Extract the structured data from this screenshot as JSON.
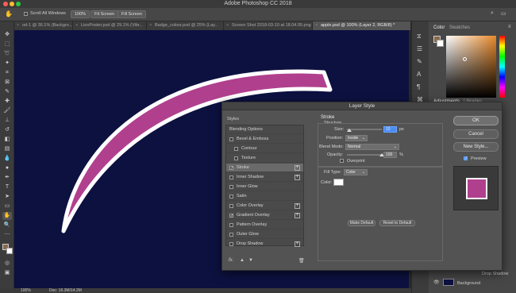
{
  "app": {
    "title": "Adobe Photoshop CC 2018"
  },
  "options": {
    "scroll_all": "Scroll All Windows",
    "zoom": "100%",
    "fit_screen": "Fit Screen",
    "fill_screen": "Fill Screen"
  },
  "tabs": [
    {
      "label": "od-1 @ 36.1% (Backgro..."
    },
    {
      "label": "LionPoster.psd @ 29.1% (Vibr..."
    },
    {
      "label": "Badge_colour.psd @ 25% (Lay..."
    },
    {
      "label": "Screen Shot 2018-03-10 at 18.04.05.png"
    },
    {
      "label": "apple.psd @ 100% (Layer 2, RGB/8) *"
    }
  ],
  "status": {
    "zoom": "100%",
    "doc": "Doc: 16.3M/14.2M"
  },
  "colors": {
    "canvas_bg": "#0d1140",
    "shape_fill": "#b0408e",
    "stroke": "#ffffff",
    "accent": "#4a8df6"
  },
  "right_panel": {
    "color_tab": "Color",
    "swatches_tab": "Swatches",
    "adjustments_tab": "Adjustments",
    "libraries_tab": "Libraries",
    "drop_shadow": "Drop Shadow",
    "layer_label": "Background"
  },
  "dialog": {
    "title": "Layer Style",
    "styles_header": "Styles",
    "style_items": [
      {
        "label": "Blending Options",
        "checkbox": false,
        "checked": false,
        "plus": false,
        "indent": false
      },
      {
        "label": "Bevel & Emboss",
        "checkbox": true,
        "checked": false,
        "plus": false,
        "indent": false
      },
      {
        "label": "Contour",
        "checkbox": true,
        "checked": false,
        "plus": false,
        "indent": true
      },
      {
        "label": "Texture",
        "checkbox": true,
        "checked": false,
        "plus": false,
        "indent": true
      },
      {
        "label": "Stroke",
        "checkbox": true,
        "checked": true,
        "plus": true,
        "indent": false
      },
      {
        "label": "Inner Shadow",
        "checkbox": true,
        "checked": false,
        "plus": true,
        "indent": false
      },
      {
        "label": "Inner Glow",
        "checkbox": true,
        "checked": false,
        "plus": false,
        "indent": false
      },
      {
        "label": "Satin",
        "checkbox": true,
        "checked": false,
        "plus": false,
        "indent": false
      },
      {
        "label": "Color Overlay",
        "checkbox": true,
        "checked": false,
        "plus": true,
        "indent": false
      },
      {
        "label": "Gradient Overlay",
        "checkbox": true,
        "checked": true,
        "plus": true,
        "indent": false
      },
      {
        "label": "Pattern Overlay",
        "checkbox": true,
        "checked": false,
        "plus": false,
        "indent": false
      },
      {
        "label": "Outer Glow",
        "checkbox": true,
        "checked": false,
        "plus": false,
        "indent": false
      },
      {
        "label": "Drop Shadow",
        "checkbox": true,
        "checked": false,
        "plus": true,
        "indent": false
      }
    ],
    "stroke": {
      "heading": "Stroke",
      "structure": "Structure",
      "size_label": "Size:",
      "size_value": "10",
      "size_unit": "px",
      "position_label": "Position:",
      "position_value": "Inside",
      "blend_label": "Blend Mode:",
      "blend_value": "Normal",
      "opacity_label": "Opacity:",
      "opacity_value": "100",
      "opacity_unit": "%",
      "overprint_label": "Overprint",
      "fill_type_label": "Fill Type:",
      "fill_type_value": "Color",
      "color_label": "Color:",
      "make_default": "Make Default",
      "reset_default": "Reset to Default"
    },
    "buttons": {
      "ok": "OK",
      "cancel": "Cancel",
      "new_style": "New Style...",
      "preview": "Preview"
    }
  }
}
